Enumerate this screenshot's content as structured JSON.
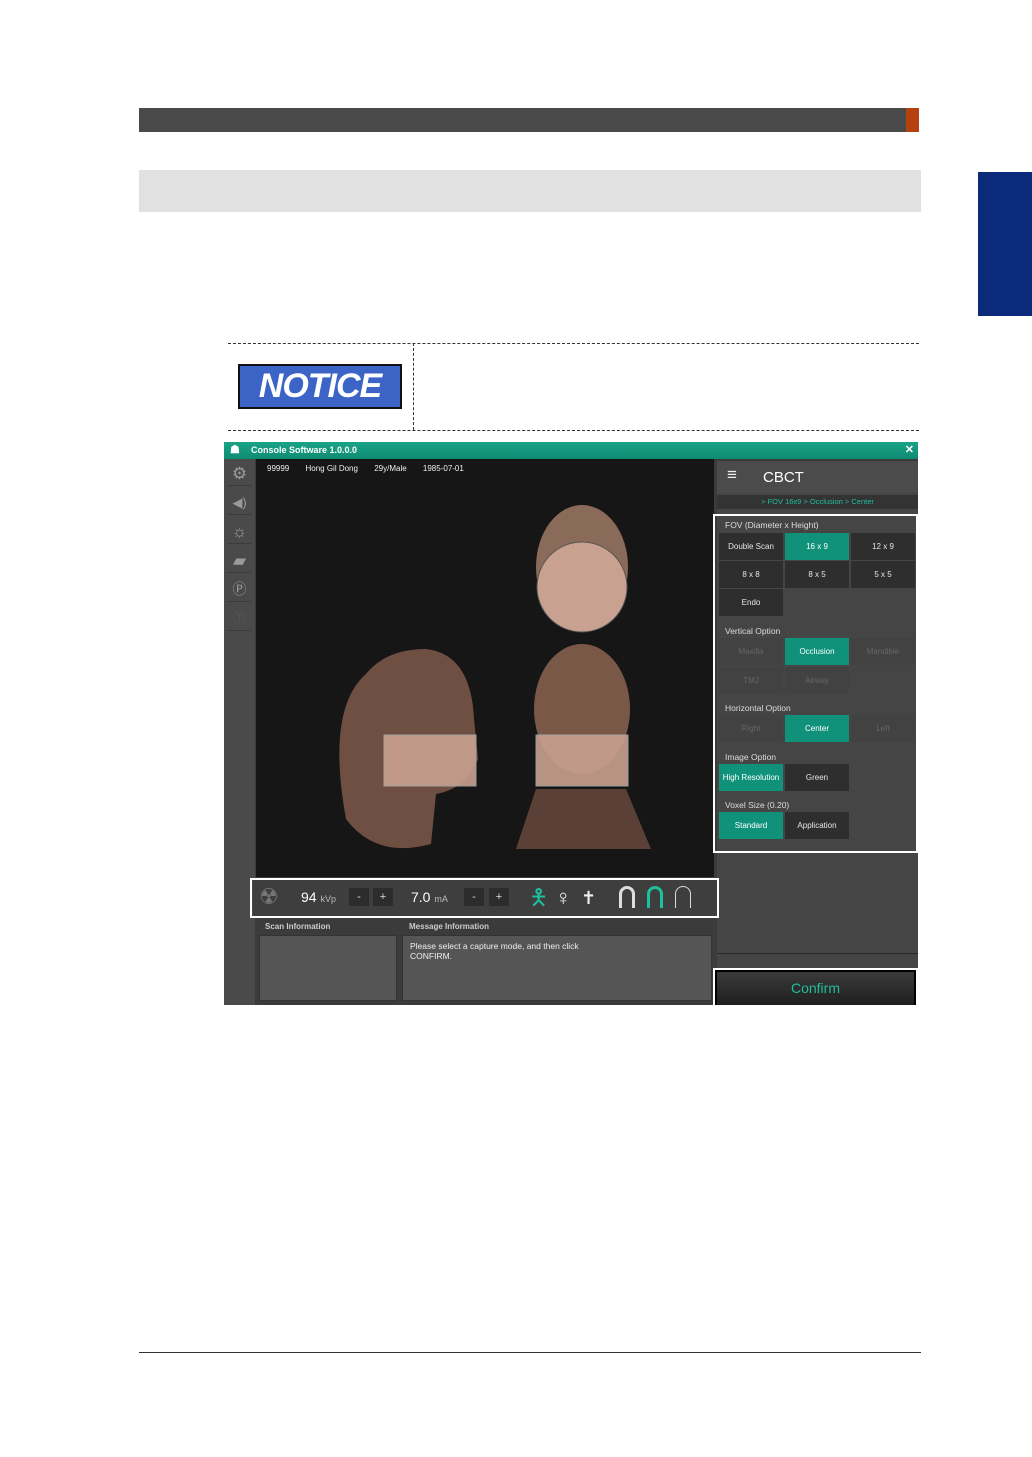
{
  "document": {
    "notice_label": "NOTICE"
  },
  "app": {
    "title": "Console Software  1.0.0.0",
    "patient": {
      "id": "99999",
      "name": "Hong Gil Dong",
      "age_sex": "29y/Male",
      "dob": "1985-07-01"
    },
    "mode": "CBCT",
    "breadcrumb": "> FOV 16x9 > Occlusion > Center",
    "fov": {
      "label": "FOV (Diameter x Height)",
      "options": [
        "Double Scan",
        "16 x 9",
        "12 x 9",
        "8 x 8",
        "8 x 5",
        "5 x 5",
        "Endo"
      ],
      "selected": "16 x 9"
    },
    "vertical": {
      "label": "Vertical Option",
      "options": [
        "Maxilla",
        "Occlusion",
        "Mandible",
        "TMJ",
        "Airway"
      ],
      "selected": "Occlusion"
    },
    "horizontal": {
      "label": "Horizontal Option",
      "options": [
        "Right",
        "Center",
        "Left"
      ],
      "selected": "Center"
    },
    "image": {
      "label": "Image Option",
      "options": [
        "High Resolution",
        "Green"
      ],
      "selected": "High Resolution"
    },
    "voxel": {
      "label": "Voxel Size (0.20)",
      "options": [
        "Standard",
        "Application"
      ],
      "selected": "Standard"
    },
    "controls": {
      "kvp": "94",
      "kvp_unit": "kVp",
      "ma": "7.0",
      "ma_unit": "mA",
      "minus": "-",
      "plus": "+"
    },
    "scan_info_label": "Scan Information",
    "message_label": "Message Information",
    "message": "Please select a capture mode, and then click CONFIRM.",
    "confirm": "Confirm",
    "close": "✕",
    "accent": "#0f9279"
  }
}
